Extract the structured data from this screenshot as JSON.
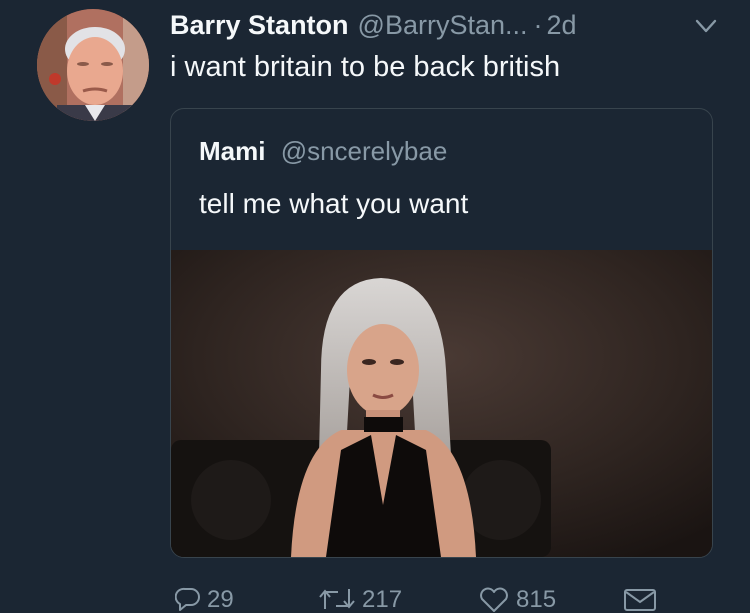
{
  "tweet": {
    "author": {
      "display_name": "Barry Stanton",
      "handle": "@BarryStan...",
      "separator": "·",
      "time": "2d"
    },
    "text": "i want britain to be back british",
    "quoted_tweet": {
      "display_name": "Mami",
      "handle": "@sncerelybae",
      "text": "tell me what you want"
    },
    "actions": {
      "reply_count": "29",
      "retweet_count": "217",
      "like_count": "815"
    }
  },
  "colors": {
    "background": "#1b2633",
    "text_primary": "#f5f8fa",
    "text_secondary": "#8899a6",
    "border": "#38444d"
  },
  "icons": {
    "reply": "reply-icon",
    "retweet": "retweet-icon",
    "like": "heart-icon",
    "dm": "envelope-icon",
    "menu": "chevron-down-icon"
  }
}
